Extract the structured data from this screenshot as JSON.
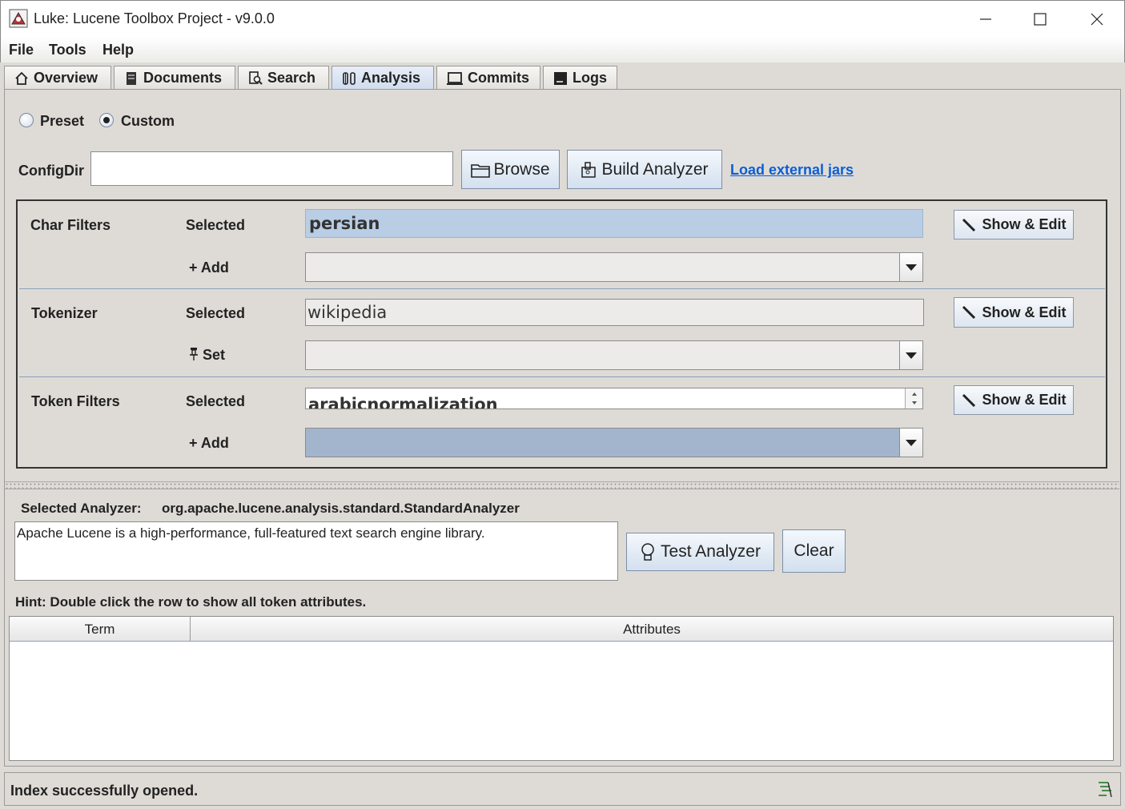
{
  "window": {
    "title": "Luke: Lucene Toolbox Project - v9.0.0"
  },
  "menu": [
    "File",
    "Tools",
    "Help"
  ],
  "tabs": [
    "Overview",
    "Documents",
    "Search",
    "Analysis",
    "Commits",
    "Logs"
  ],
  "mode": {
    "preset_label": "Preset",
    "custom_label": "Custom",
    "selected": "Custom"
  },
  "config": {
    "configdir_label": "ConfigDir",
    "configdir_value": "",
    "browse_label": "Browse",
    "build_label": "Build Analyzer",
    "load_jars_label": "Load external jars"
  },
  "char_filters": {
    "label": "Char Filters",
    "selected_label": "Selected",
    "selected_value": "persian",
    "add_label": "Add",
    "edit_label": "Show & Edit"
  },
  "tokenizer": {
    "label": "Tokenizer",
    "selected_label": "Selected",
    "selected_value": "wikipedia",
    "set_label": "Set",
    "edit_label": "Show & Edit"
  },
  "token_filters": {
    "label": "Token Filters",
    "selected_label": "Selected",
    "selected_value": "arabicnormalization",
    "add_label": "Add",
    "edit_label": "Show & Edit"
  },
  "analyzer": {
    "selected_label": "Selected Analyzer:",
    "selected_value": "org.apache.lucene.analysis.standard.StandardAnalyzer",
    "input_text": "Apache Lucene is a high-performance, full-featured text search engine library.",
    "test_label": "Test Analyzer",
    "clear_label": "Clear"
  },
  "hint": "Hint: Double click the row to show all token attributes.",
  "table": {
    "columns": [
      "Term",
      "Attributes"
    ]
  },
  "status": {
    "message": "Index successfully opened."
  },
  "colors": {
    "tab_active": "#cfdcee",
    "link": "#0b5ed7",
    "selection": "#b9cde5",
    "combo_selected": "#a3b5cc"
  },
  "icons": [
    "app-icon",
    "minimize-icon",
    "maximize-icon",
    "close-icon",
    "home-icon",
    "documents-icon",
    "search-icon",
    "analysis-icon",
    "commits-icon",
    "logs-icon",
    "folder-icon",
    "build-icon",
    "wand-icon",
    "pin-icon",
    "bulb-icon",
    "status-icon"
  ]
}
